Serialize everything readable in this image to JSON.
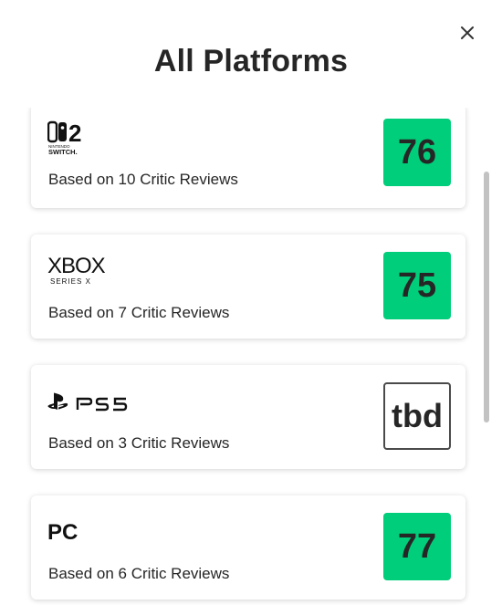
{
  "modal": {
    "title": "All Platforms",
    "close_icon": "close-icon"
  },
  "platforms": [
    {
      "name": "Nintendo Switch 2",
      "logo_icon": "nintendo-switch-2-logo",
      "logo_small_text": "NINTENDO",
      "logo_sub_text": "SWITCH.",
      "logo_number": "2",
      "reviews": "Based on 10 Critic Reviews",
      "score": "76",
      "score_color": "#00ce7a"
    },
    {
      "name": "Xbox Series X",
      "logo_icon": "xbox-series-x-logo",
      "logo_main_text": "XBOX",
      "logo_sub_text": "SERIES X",
      "reviews": "Based on 7 Critic Reviews",
      "score": "75",
      "score_color": "#00ce7a"
    },
    {
      "name": "PS5",
      "logo_icon": "ps5-logo",
      "reviews": "Based on 3 Critic Reviews",
      "score": "tbd",
      "score_color": "#ffffff"
    },
    {
      "name": "PC",
      "logo_icon": "pc-logo",
      "logo_main_text": "PC",
      "reviews": "Based on 6 Critic Reviews",
      "score": "77",
      "score_color": "#00ce7a"
    }
  ]
}
